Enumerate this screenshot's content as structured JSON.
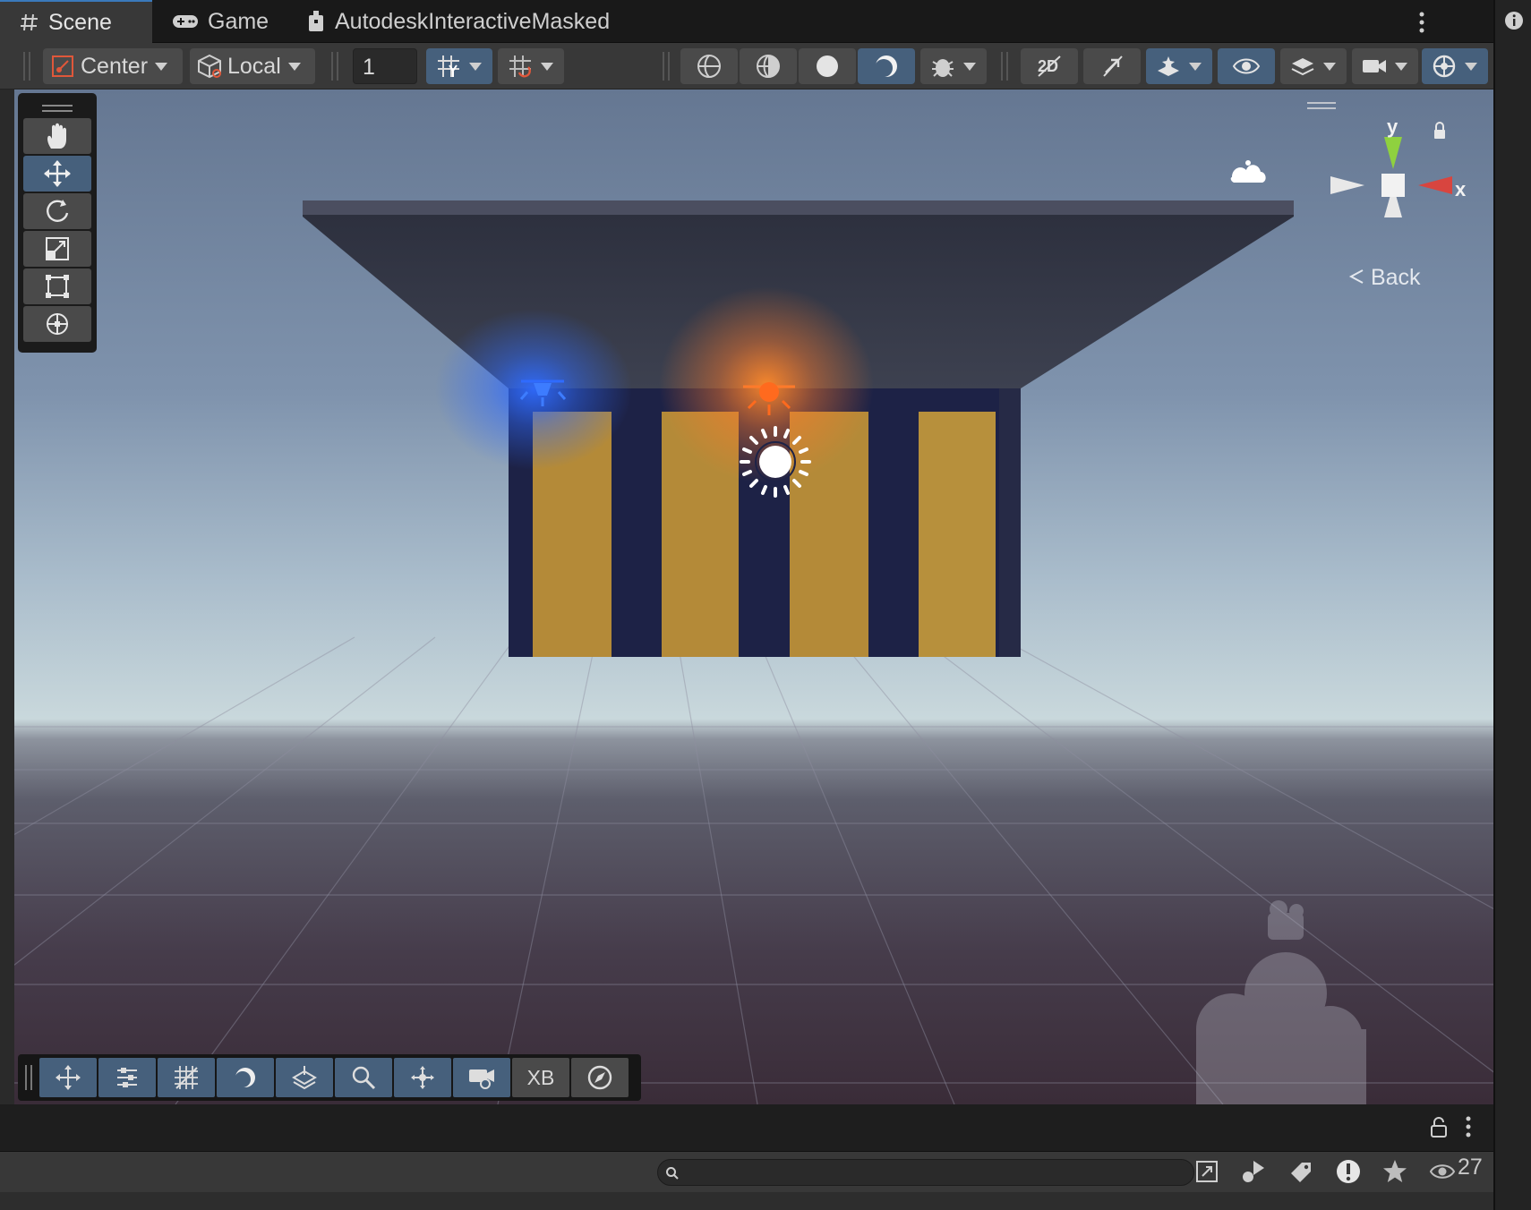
{
  "tabs": [
    {
      "label": "Scene",
      "icon": "grid-hash-icon",
      "active": true
    },
    {
      "label": "Game",
      "icon": "gamepad-icon",
      "active": false
    },
    {
      "label": "AutodeskInteractiveMasked",
      "icon": "package-icon",
      "active": false
    }
  ],
  "toolbar": {
    "pivot_mode": "Center",
    "pivot_rotation": "Local",
    "grid_snap_value": "1"
  },
  "gizmo": {
    "y_label": "y",
    "x_label": "x",
    "back_label": "Back",
    "colors": {
      "y": "#8fd13f",
      "x": "#d8453f",
      "neutral": "#e8e8e8"
    }
  },
  "overlay_toolbar": {
    "xb_label": "XB"
  },
  "bottom_panel": {
    "visible_count": "27"
  },
  "colors": {
    "accent_active": "#46607c",
    "tab_accent": "#3a79bb",
    "building_dark": "#1d2246",
    "building_panel": "#b48a38",
    "blue_light": "#2f6bff",
    "orange_light": "#ff7a2a"
  }
}
